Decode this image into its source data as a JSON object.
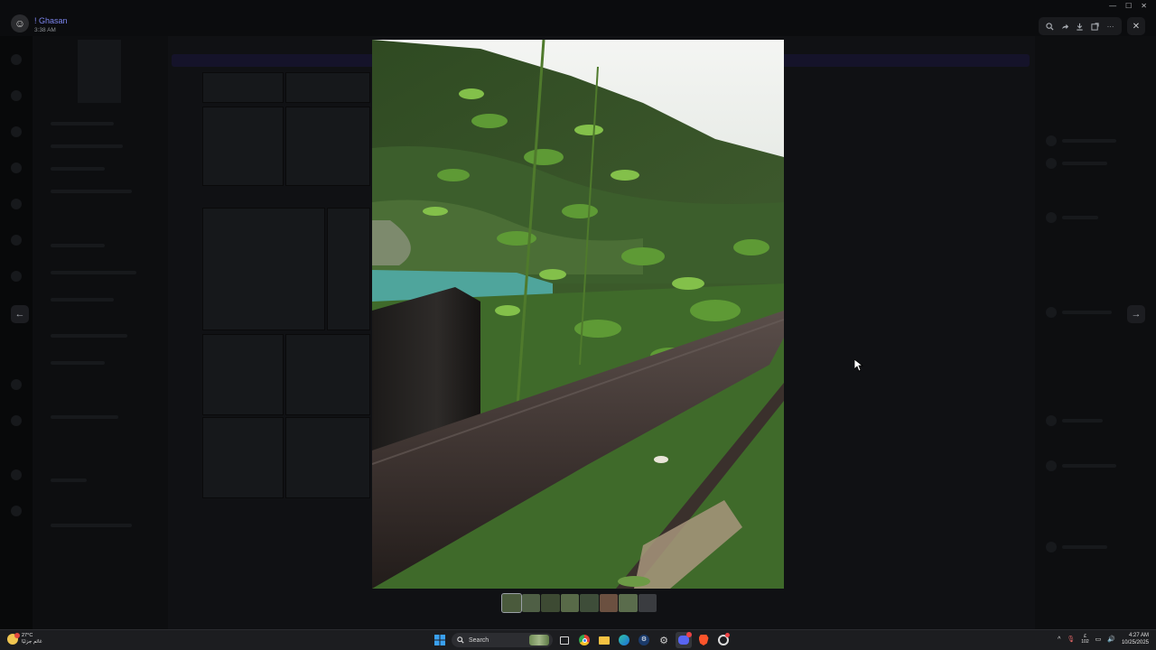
{
  "viewer": {
    "user": {
      "name": "! Ghasan",
      "time": "3:38 AM",
      "avatar_icon": "ghost-avatar"
    },
    "toolbar": {
      "tools": [
        "zoom-icon",
        "forward-icon",
        "download-icon",
        "open-external-icon",
        "more-icon"
      ],
      "close_icon": "close-icon"
    },
    "nav": {
      "prev_icon": "arrow-left-icon",
      "next_icon": "arrow-right-icon"
    },
    "thumbnails_count": 8,
    "thumbnail_colors": [
      "#4a5a3c",
      "#4f5f45",
      "#3d4a33",
      "#586a48",
      "#3e4d39",
      "#6b5040",
      "#5a6c4c",
      "#3a3c40"
    ]
  },
  "taskbar": {
    "weather": {
      "temp": "27°C",
      "desc": "غائم جزئيًا"
    },
    "search": {
      "label": "Search"
    },
    "tray": {
      "notif_num": "102",
      "time": "4:27 AM",
      "date": "10/25/2025"
    }
  }
}
